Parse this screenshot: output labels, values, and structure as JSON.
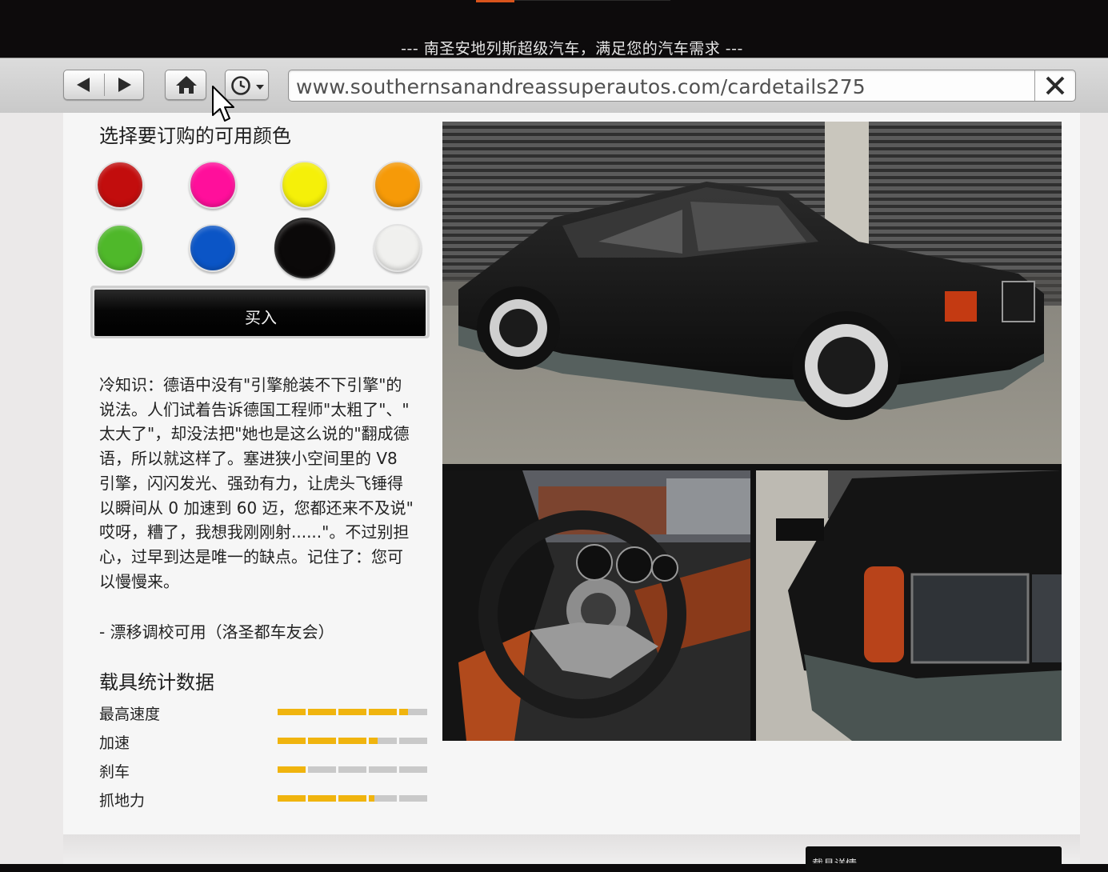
{
  "banner": {
    "tagline": "--- 南圣安地列斯超级汽车，满足您的汽车需求 ---"
  },
  "browser": {
    "url": "www.southernsanandreassuperautos.com/cardetails275",
    "icons": {
      "back": "back-arrow-icon",
      "forward": "forward-arrow-icon",
      "home": "home-icon",
      "history": "history-clock-icon",
      "close": "close-icon"
    }
  },
  "colors_section": {
    "title": "选择要订购的可用颜色",
    "swatches": [
      {
        "name": "red",
        "color": "#c20d0d",
        "selected": false
      },
      {
        "name": "pink",
        "color": "#ff0f9b",
        "selected": false
      },
      {
        "name": "yellow",
        "color": "#f5f009",
        "selected": false
      },
      {
        "name": "orange",
        "color": "#f69a08",
        "selected": false
      },
      {
        "name": "green",
        "color": "#4fb82a",
        "selected": false
      },
      {
        "name": "blue",
        "color": "#0b55c6",
        "selected": false
      },
      {
        "name": "black",
        "color": "#0b0909",
        "selected": true
      },
      {
        "name": "white",
        "color": "#f0f0ee",
        "selected": false
      }
    ]
  },
  "buy_button": {
    "label": "买入"
  },
  "description": {
    "lines": [
      "冷知识：德语中没有\"引擎舱装不下引擎\"的",
      "说法。人们试着告诉德国工程师\"太粗了\"、\"",
      "太大了\"，却没法把\"她也是这么说的\"翻成德",
      "语，所以就这样了。塞进狭小空间里的 V8",
      "引擎，闪闪发光、强劲有力，让虎头飞锤得",
      "以瞬间从 0 加速到 60 迈，您都还来不及说\"",
      "哎呀，糟了，我想我刚刚射......\"。不过别担",
      "心，过早到达是唯一的缺点。记住了：您可",
      "以慢慢来。"
    ],
    "drift_note": "- 漂移调校可用（洛圣都车友会）"
  },
  "stats": {
    "title": "载具统计数据",
    "items": [
      {
        "label": "最高速度",
        "value": 0.86
      },
      {
        "label": "加速",
        "value": 0.66
      },
      {
        "label": "刹车",
        "value": 0.2
      },
      {
        "label": "抓地力",
        "value": 0.64
      }
    ],
    "segments": 5,
    "fill_color": "#f0b40e",
    "empty_color": "#c9c9c9"
  },
  "footer": {
    "button_label": "载具详情"
  }
}
